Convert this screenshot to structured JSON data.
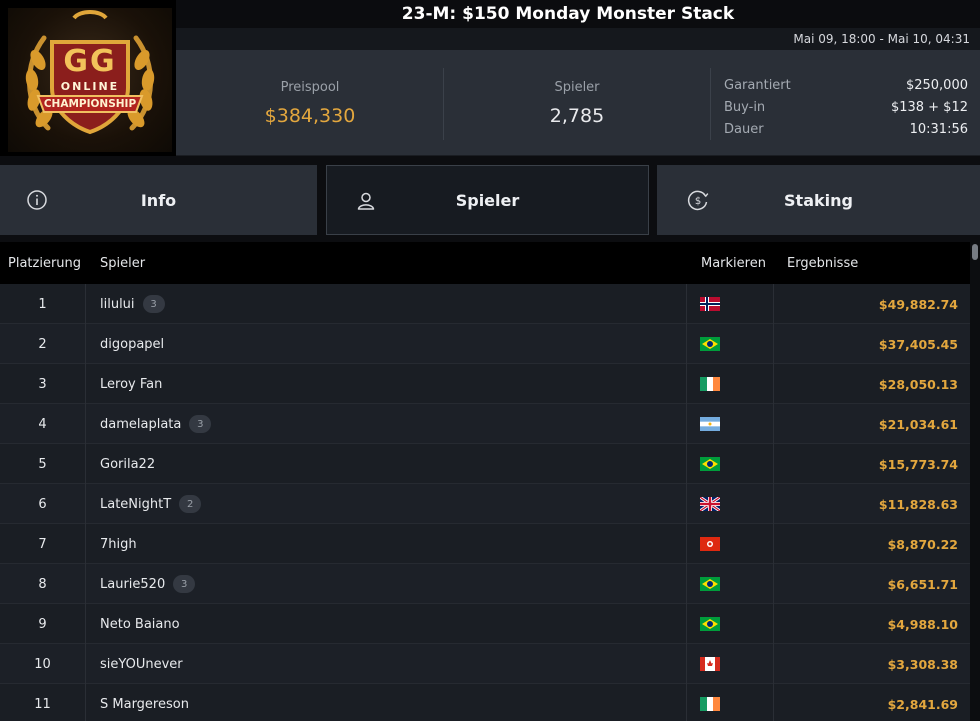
{
  "header": {
    "title": "23-M: $150 Monday Monster Stack",
    "date_range": "Mai 09, 18:00 - Mai 10, 04:31",
    "logo_text": {
      "top": "GG",
      "mid": "ONLINE",
      "bottom": "CHAMPIONSHIP"
    }
  },
  "stats": {
    "prizepool_label": "Preispool",
    "prizepool_value": "$384,330",
    "players_label": "Spieler",
    "players_value": "2,785",
    "details": [
      {
        "label": "Garantiert",
        "value": "$250,000"
      },
      {
        "label": "Buy-in",
        "value": "$138 + $12"
      },
      {
        "label": "Dauer",
        "value": "10:31:56"
      }
    ]
  },
  "tabs": [
    {
      "label": "Info",
      "icon": "info-icon",
      "active": false
    },
    {
      "label": "Spieler",
      "icon": "user-icon",
      "active": true
    },
    {
      "label": "Staking",
      "icon": "dollar-circle-icon",
      "active": false
    }
  ],
  "table": {
    "headers": {
      "rank": "Platzierung",
      "player": "Spieler",
      "flag": "Markieren",
      "result": "Ergebnisse"
    },
    "rows": [
      {
        "rank": "1",
        "name": "lilului",
        "badge": "3",
        "flag": "norway",
        "result": "$49,882.74"
      },
      {
        "rank": "2",
        "name": "digopapel",
        "badge": "",
        "flag": "brazil",
        "result": "$37,405.45"
      },
      {
        "rank": "3",
        "name": "Leroy Fan",
        "badge": "",
        "flag": "ireland",
        "result": "$28,050.13"
      },
      {
        "rank": "4",
        "name": "damelaplata",
        "badge": "3",
        "flag": "argentina",
        "result": "$21,034.61"
      },
      {
        "rank": "5",
        "name": "Gorila22",
        "badge": "",
        "flag": "brazil",
        "result": "$15,773.74"
      },
      {
        "rank": "6",
        "name": "LateNightT",
        "badge": "2",
        "flag": "uk",
        "result": "$11,828.63"
      },
      {
        "rank": "7",
        "name": "7high",
        "badge": "",
        "flag": "hongkong",
        "result": "$8,870.22"
      },
      {
        "rank": "8",
        "name": "Laurie520",
        "badge": "3",
        "flag": "brazil",
        "result": "$6,651.71"
      },
      {
        "rank": "9",
        "name": "Neto Baiano",
        "badge": "",
        "flag": "brazil",
        "result": "$4,988.10"
      },
      {
        "rank": "10",
        "name": "sieYOUnever",
        "badge": "",
        "flag": "canada",
        "result": "$3,308.38"
      },
      {
        "rank": "11",
        "name": "S Margereson",
        "badge": "",
        "flag": "ireland",
        "result": "$2,841.69"
      }
    ]
  },
  "colors": {
    "accent_gold": "#e3a73e",
    "panel": "#2a2f37",
    "bg": "#0c0d10"
  }
}
